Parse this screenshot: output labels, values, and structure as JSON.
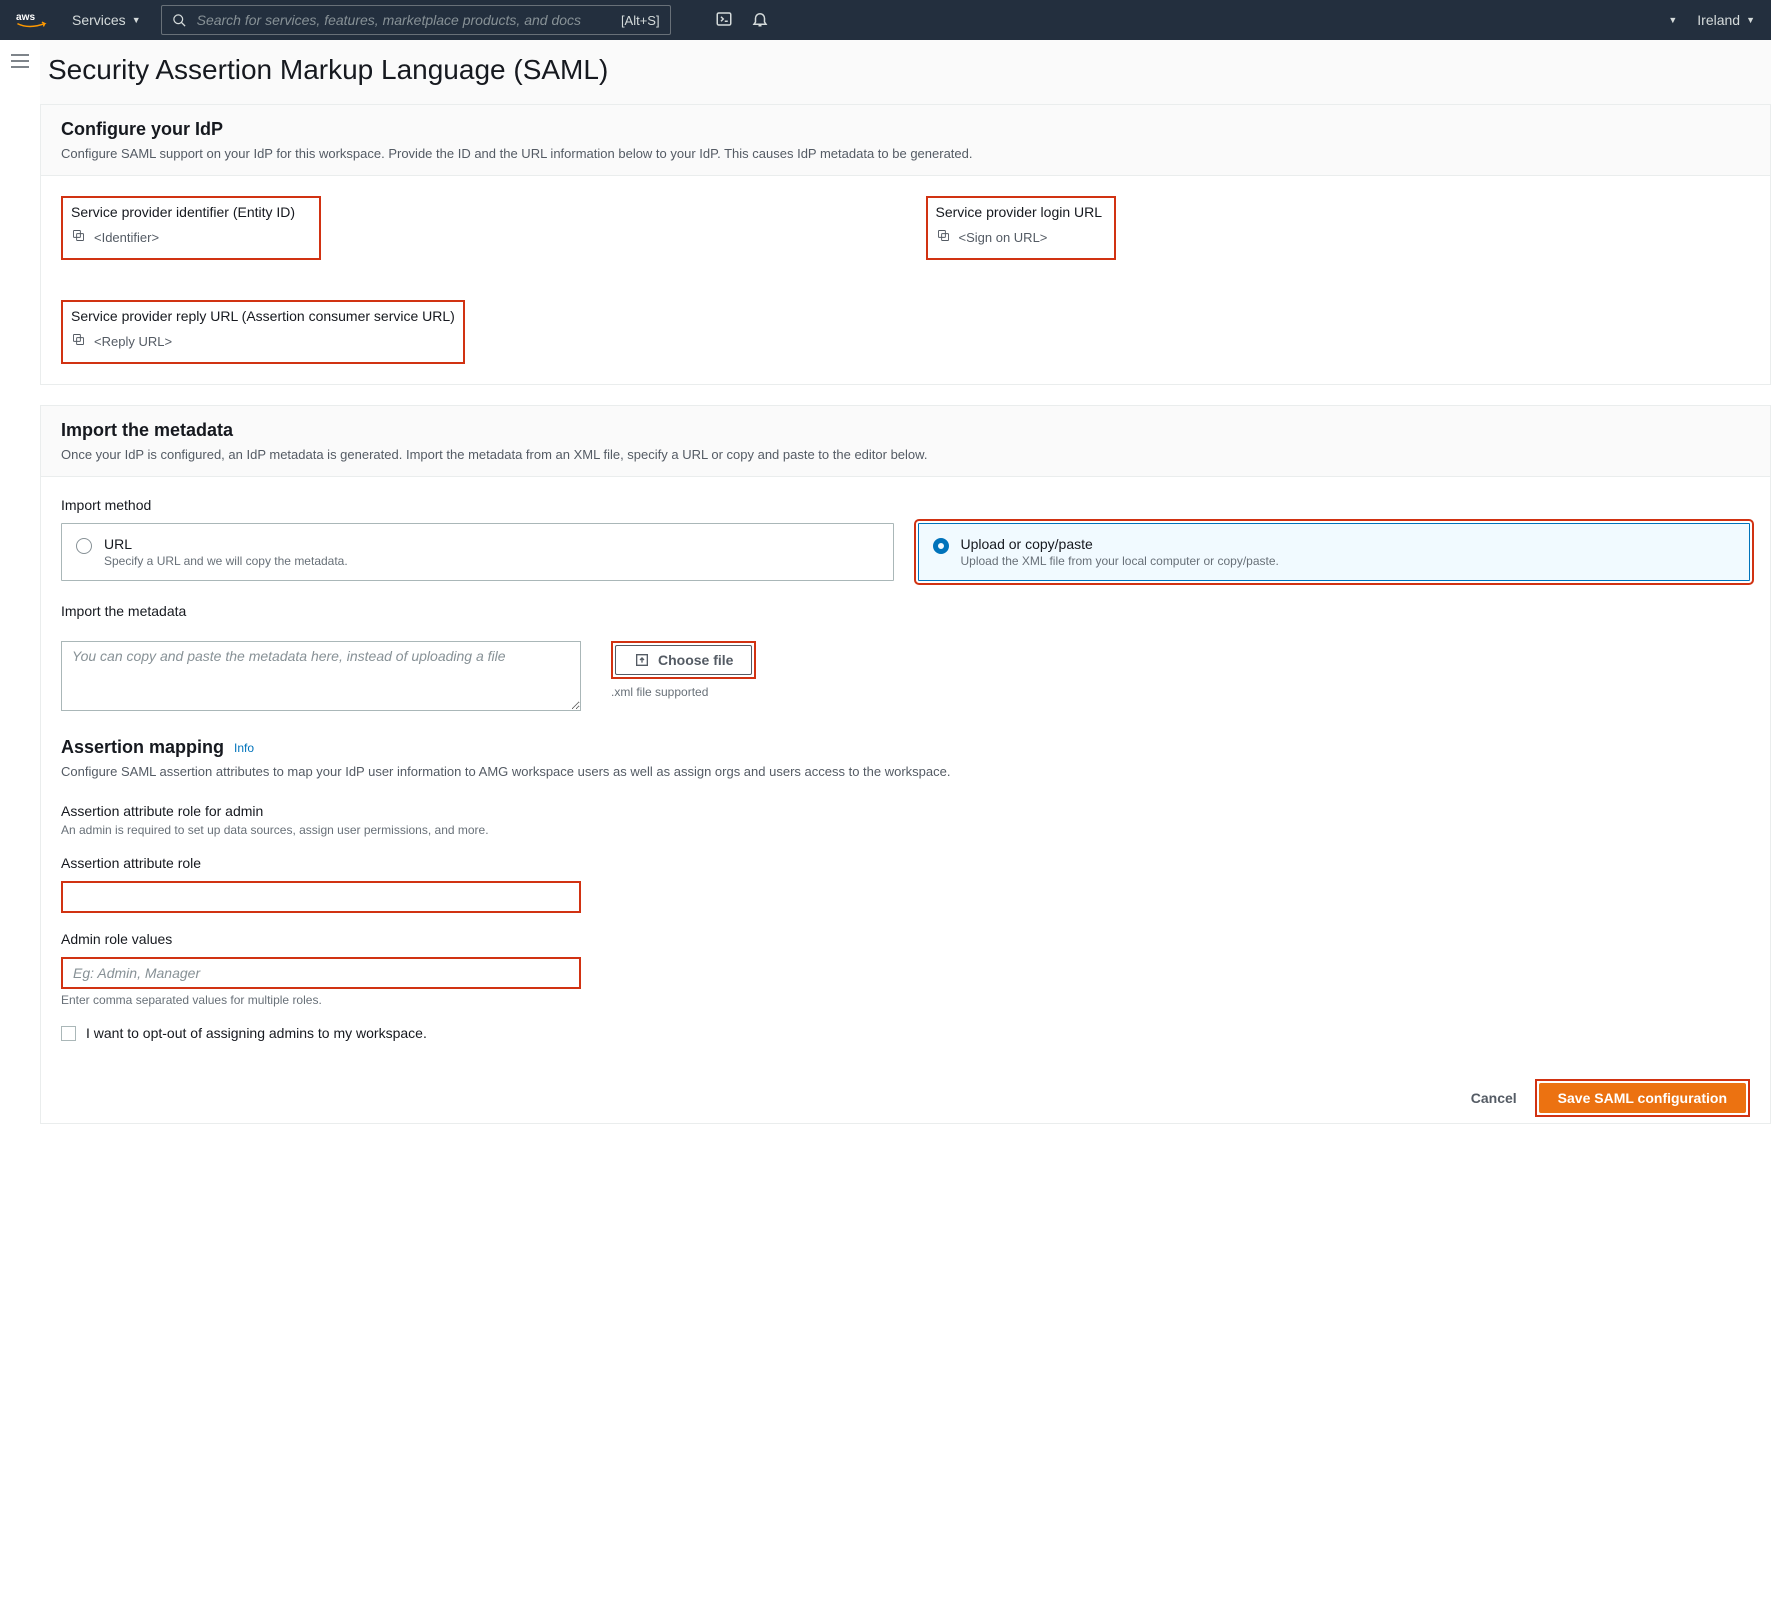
{
  "nav": {
    "services": "Services",
    "search_placeholder": "Search for services, features, marketplace products, and docs",
    "search_kbd": "[Alt+S]",
    "region": "Ireland"
  },
  "page": {
    "title": "Security Assertion Markup Language (SAML)"
  },
  "configure": {
    "heading": "Configure your IdP",
    "sub": "Configure SAML support on your IdP for this workspace. Provide the ID and the URL information below to your IdP. This causes IdP metadata to be generated.",
    "entity_label": "Service provider identifier (Entity ID)",
    "entity_value": "<Identifier>",
    "login_label": "Service provider login URL",
    "login_value": "<Sign on URL>",
    "reply_label": "Service provider reply URL (Assertion consumer service URL)",
    "reply_value": "<Reply URL>"
  },
  "import": {
    "heading": "Import the metadata",
    "sub": "Once your IdP is configured, an IdP metadata is generated. Import the metadata from an XML file, specify a URL or copy and paste to the editor below.",
    "method_label": "Import method",
    "url_title": "URL",
    "url_sub": "Specify a URL and we will copy the metadata.",
    "upload_title": "Upload or copy/paste",
    "upload_sub": "Upload the XML file from your local computer or copy/paste.",
    "meta_label": "Import the metadata",
    "meta_placeholder": "You can copy and paste the metadata here, instead of uploading a file",
    "choose_file": "Choose file",
    "file_hint": ".xml file supported"
  },
  "assertion": {
    "heading": "Assertion mapping",
    "info": "Info",
    "sub": "Configure SAML assertion attributes to map your IdP user information to AMG workspace users as well as assign orgs and users access to the workspace.",
    "admin_role_head": "Assertion attribute role for admin",
    "admin_role_sub": "An admin is required to set up data sources, assign user permissions, and more.",
    "role_label": "Assertion attribute role",
    "values_label": "Admin role values",
    "values_placeholder": "Eg: Admin, Manager",
    "values_hint": "Enter comma separated values for multiple roles.",
    "optout": "I want to opt-out of assigning admins to my workspace."
  },
  "footer": {
    "cancel": "Cancel",
    "save": "Save SAML configuration"
  }
}
